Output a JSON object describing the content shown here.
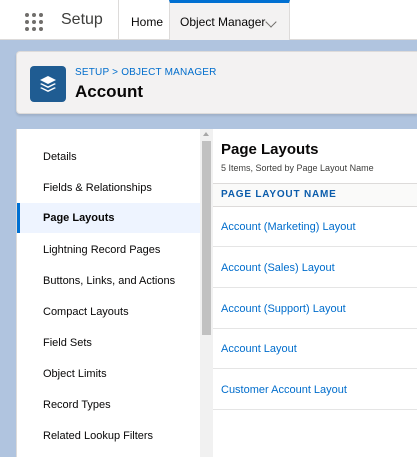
{
  "header": {
    "app_name": "Setup",
    "tabs": [
      {
        "label": "Home"
      },
      {
        "label": "Object Manager"
      }
    ]
  },
  "page_header": {
    "breadcrumb": [
      "SETUP",
      "OBJECT MANAGER"
    ],
    "breadcrumb_separator": ">",
    "title": "Account",
    "icon": "layers-icon"
  },
  "sidebar": {
    "items": [
      {
        "label": "Details"
      },
      {
        "label": "Fields & Relationships"
      },
      {
        "label": "Page Layouts",
        "active": true
      },
      {
        "label": "Lightning Record Pages"
      },
      {
        "label": "Buttons, Links, and Actions"
      },
      {
        "label": "Compact Layouts"
      },
      {
        "label": "Field Sets"
      },
      {
        "label": "Object Limits"
      },
      {
        "label": "Record Types"
      },
      {
        "label": "Related Lookup Filters"
      }
    ]
  },
  "main": {
    "title": "Page Layouts",
    "subtitle": "5 Items, Sorted by Page Layout Name",
    "column_header": "PAGE LAYOUT NAME",
    "rows": [
      {
        "name": "Account (Marketing) Layout"
      },
      {
        "name": "Account (Sales) Layout"
      },
      {
        "name": "Account (Support) Layout"
      },
      {
        "name": "Account Layout"
      },
      {
        "name": "Customer Account Layout"
      }
    ]
  },
  "colors": {
    "brand_blue": "#0070d2",
    "link_blue": "#006dcc",
    "icon_bg": "#1f5c92",
    "page_bg": "#b0c4df"
  }
}
